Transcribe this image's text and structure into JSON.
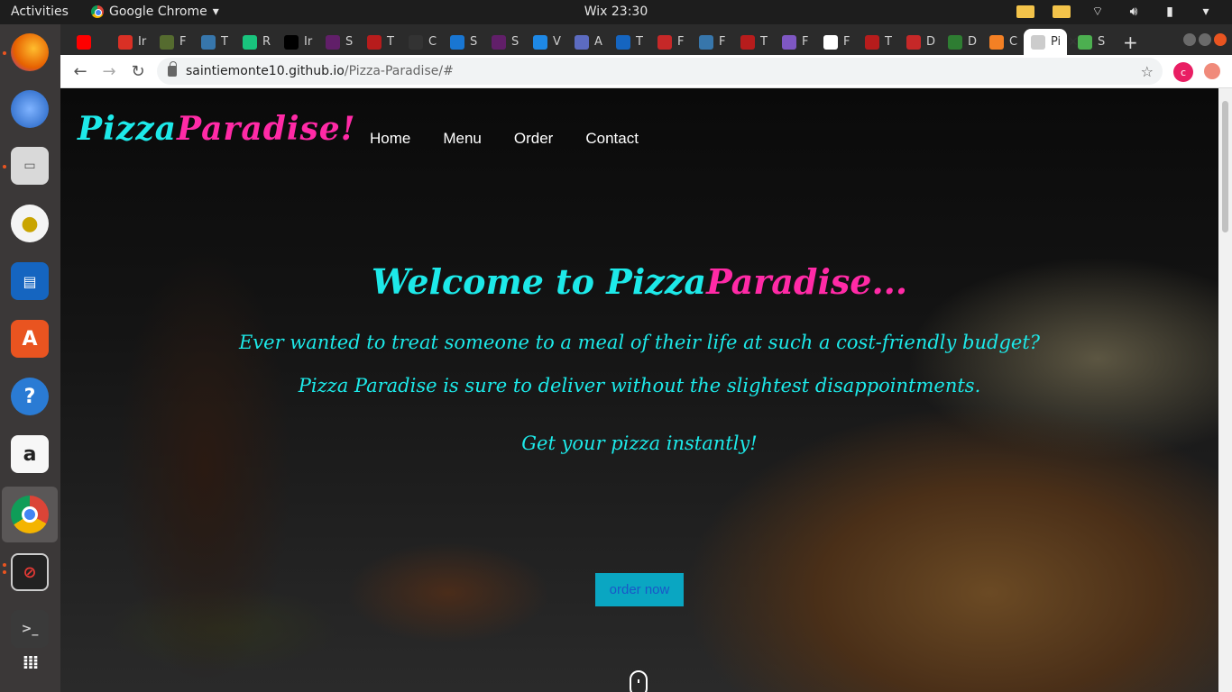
{
  "topbar": {
    "activities": "Activities",
    "app_name": "Google Chrome",
    "clock": "Wix 23:30"
  },
  "dock": {
    "items": [
      "Firefox",
      "Thunderbird",
      "Files",
      "Rhythmbox",
      "LibreOffice Writer",
      "Ubuntu Software",
      "Help",
      "Amazon",
      "Google Chrome",
      "Blocked app",
      "Terminal",
      "Show Applications"
    ]
  },
  "browser": {
    "tabs": [
      {
        "label": "",
        "icon": "youtube-icon",
        "color": "#ff0000"
      },
      {
        "label": "Ir",
        "icon": "gmail-icon",
        "color": "#d93025"
      },
      {
        "label": "F",
        "icon": "generic-icon",
        "color": "#556b2f"
      },
      {
        "label": "T",
        "icon": "python-icon",
        "color": "#3776ab"
      },
      {
        "label": "R",
        "icon": "generic-icon",
        "color": "#19c37d"
      },
      {
        "label": "Ir",
        "icon": "hn-icon",
        "color": "#000000"
      },
      {
        "label": "S",
        "icon": "slack-icon",
        "color": "#611f69"
      },
      {
        "label": "T",
        "icon": "generic-icon",
        "color": "#b71c1c"
      },
      {
        "label": "C",
        "icon": "generic-icon",
        "color": "#333333"
      },
      {
        "label": "S",
        "icon": "terminal-icon",
        "color": "#1976d2"
      },
      {
        "label": "S",
        "icon": "slack-icon",
        "color": "#611f69"
      },
      {
        "label": "V",
        "icon": "generic-icon",
        "color": "#1e88e5"
      },
      {
        "label": "A",
        "icon": "generic-icon",
        "color": "#5c6bc0"
      },
      {
        "label": "T",
        "icon": "generic-icon",
        "color": "#1565c0"
      },
      {
        "label": "F",
        "icon": "generic-icon",
        "color": "#c62828"
      },
      {
        "label": "F",
        "icon": "python-icon",
        "color": "#3776ab"
      },
      {
        "label": "T",
        "icon": "generic-icon",
        "color": "#b71c1c"
      },
      {
        "label": "F",
        "icon": "generic-icon",
        "color": "#7e57c2"
      },
      {
        "label": "F",
        "icon": "generic-icon",
        "color": "#ffffff"
      },
      {
        "label": "T",
        "icon": "generic-icon",
        "color": "#b71c1c"
      },
      {
        "label": "D",
        "icon": "generic-icon",
        "color": "#c62828"
      },
      {
        "label": "D",
        "icon": "generic-icon",
        "color": "#2e7d32"
      },
      {
        "label": "C",
        "icon": "stackoverflow-icon",
        "color": "#f48024"
      },
      {
        "label": "Pi",
        "icon": "generic-icon",
        "color": "#cccccc",
        "active": true
      },
      {
        "label": "S",
        "icon": "generic-icon",
        "color": "#4caf50"
      }
    ],
    "url_host": "saintiemonte10.github.io",
    "url_path": "/Pizza-Paradise/#",
    "profile_initial": "c"
  },
  "site": {
    "logo_part1": "Pizza",
    "logo_part2": "Paradise!",
    "nav": [
      "Home",
      "Menu",
      "Order",
      "Contact"
    ],
    "hero_title_part1": "Welcome to Pizza",
    "hero_title_part2": "Paradise...",
    "line1": "Ever wanted to treat someone to a meal of their life at such a cost-friendly budget?",
    "line2": "Pizza Paradise is sure to deliver without the slightest disappointments.",
    "line3": "Get your pizza instantly!",
    "order_button": "order now"
  },
  "colors": {
    "accent_cyan": "#1de9e9",
    "accent_pink": "#ff2aa6",
    "button_bg": "#0aa6c2"
  }
}
